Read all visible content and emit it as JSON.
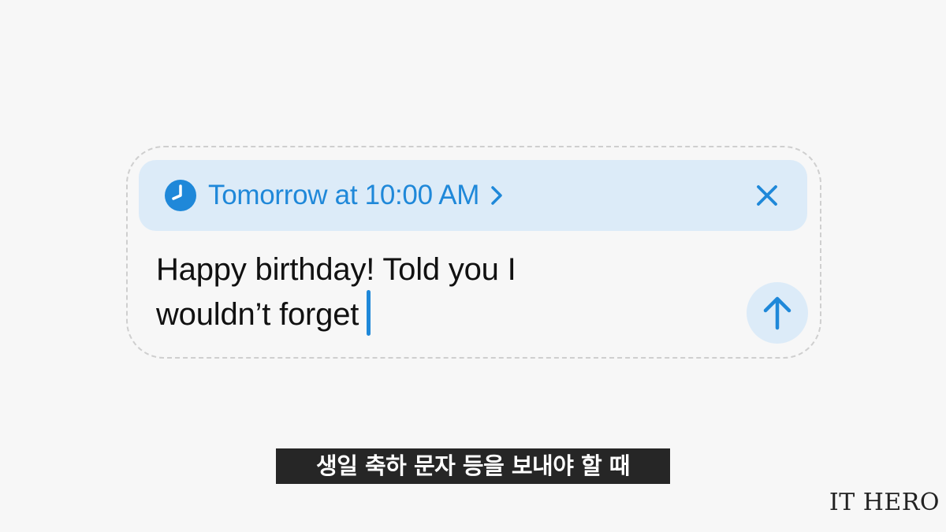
{
  "schedule": {
    "label": "Tomorrow at 10:00 AM",
    "icon": "clock-icon",
    "chevron_icon": "chevron-right-icon",
    "close_icon": "close-icon"
  },
  "message": {
    "line1": "Happy birthday! Told you I",
    "line2": "wouldn’t forget"
  },
  "send": {
    "icon": "arrow-up-icon"
  },
  "subtitle": {
    "text": "생일 축하 문자 등을 보내야 할 때"
  },
  "watermark": {
    "text": "IT HERO"
  },
  "colors": {
    "accent": "#1f88d9",
    "bar_background": "#dcebf8",
    "page_background": "#f7f7f7",
    "subtitle_background": "#262626"
  }
}
